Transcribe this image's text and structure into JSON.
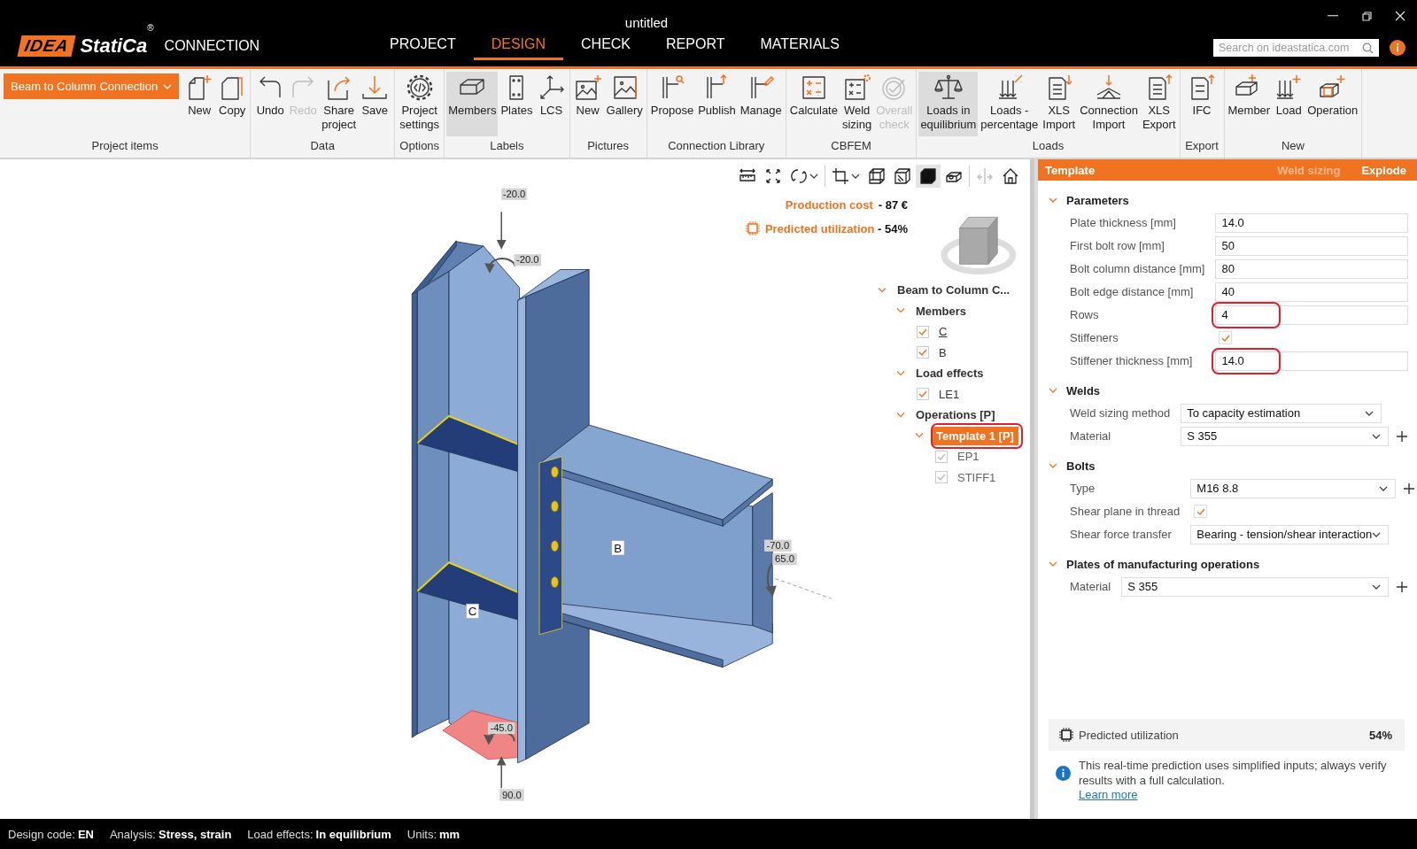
{
  "window": {
    "title": "untitled"
  },
  "logo": {
    "mark": "IDEA",
    "name": "StatiCa",
    "registered": "®",
    "product": "CONNECTION"
  },
  "menu_tabs": [
    {
      "label": "PROJECT",
      "selected": false
    },
    {
      "label": "DESIGN",
      "selected": true
    },
    {
      "label": "CHECK",
      "selected": false
    },
    {
      "label": "REPORT",
      "selected": false
    },
    {
      "label": "MATERIALS",
      "selected": false
    }
  ],
  "search": {
    "placeholder": "Search on ideastatica.com"
  },
  "ribbon": {
    "connection_dropdown": {
      "value": "Beam to Column Connection"
    },
    "groups": [
      {
        "label": "Project items",
        "buttons": [
          {
            "label": "New",
            "selected": false,
            "disabled": false
          },
          {
            "label": "Copy",
            "selected": false,
            "disabled": false
          }
        ]
      },
      {
        "label": "Data",
        "buttons": [
          {
            "label": "Undo",
            "selected": false,
            "disabled": false
          },
          {
            "label": "Redo",
            "selected": false,
            "disabled": true
          },
          {
            "label": "Share project",
            "selected": false,
            "disabled": false
          },
          {
            "label": "Save",
            "selected": false,
            "disabled": false
          }
        ]
      },
      {
        "label": "Options",
        "buttons": [
          {
            "label": "Project settings",
            "selected": false,
            "disabled": false
          }
        ]
      },
      {
        "label": "Labels",
        "buttons": [
          {
            "label": "Members",
            "selected": true,
            "disabled": false
          },
          {
            "label": "Plates",
            "selected": false,
            "disabled": false
          },
          {
            "label": "LCS",
            "selected": false,
            "disabled": false
          }
        ]
      },
      {
        "label": "Pictures",
        "buttons": [
          {
            "label": "New",
            "selected": false,
            "disabled": false
          },
          {
            "label": "Gallery",
            "selected": false,
            "disabled": false
          }
        ]
      },
      {
        "label": "Connection Library",
        "buttons": [
          {
            "label": "Propose",
            "selected": false,
            "disabled": false
          },
          {
            "label": "Publish",
            "selected": false,
            "disabled": false
          },
          {
            "label": "Manage",
            "selected": false,
            "disabled": false
          }
        ]
      },
      {
        "label": "CBFEM",
        "buttons": [
          {
            "label": "Calculate",
            "selected": false,
            "disabled": false
          },
          {
            "label": "Weld sizing",
            "selected": false,
            "disabled": false
          },
          {
            "label": "Overall check",
            "selected": false,
            "disabled": true
          }
        ]
      },
      {
        "label": "Loads",
        "buttons": [
          {
            "label": "Loads in equilibrium",
            "selected": true,
            "disabled": false
          },
          {
            "label": "Loads - percentage",
            "selected": false,
            "disabled": false
          },
          {
            "label": "XLS Import",
            "selected": false,
            "disabled": false
          },
          {
            "label": "Connection Import",
            "selected": false,
            "disabled": false
          },
          {
            "label": "XLS Export",
            "selected": false,
            "disabled": false
          }
        ]
      },
      {
        "label": "Export",
        "buttons": [
          {
            "label": "IFC",
            "selected": false,
            "disabled": false
          }
        ]
      },
      {
        "label": "New",
        "buttons": [
          {
            "label": "Member",
            "selected": false,
            "disabled": false
          },
          {
            "label": "Load",
            "selected": false,
            "disabled": false
          },
          {
            "label": "Operation",
            "selected": false,
            "disabled": false
          }
        ]
      }
    ]
  },
  "viewport": {
    "tools": [
      {
        "selected": false,
        "disabled": false
      },
      {
        "selected": false,
        "disabled": false
      },
      {
        "selected": false,
        "disabled": false
      },
      {
        "selected": false,
        "disabled": false
      },
      {
        "selected": false,
        "disabled": false
      },
      {
        "selected": false,
        "disabled": false
      },
      {
        "selected": true,
        "disabled": false
      },
      {
        "selected": false,
        "disabled": false
      },
      {
        "selected": false,
        "disabled": true
      },
      {
        "selected": false,
        "disabled": false
      }
    ],
    "production_cost": {
      "label": "Production cost",
      "value": "- 87 €"
    },
    "predicted_utilization": {
      "label": "Predicted utilization",
      "value": "- 54%"
    },
    "member_labels": [
      "B",
      "C"
    ],
    "load_values": [
      "-20.0",
      "-20.0",
      "-70.0",
      "65.0",
      "-45.0",
      "90.0"
    ],
    "tree": [
      {
        "label": "Beam to Column C...",
        "expanded": true,
        "selected": false,
        "highlighted": false,
        "children": [
          {
            "label": "Members",
            "expanded": true,
            "selected": false,
            "highlighted": false,
            "children": [
              {
                "label": "C",
                "checked": true,
                "disabled": false,
                "hovered": true,
                "selected": false,
                "highlighted": false
              },
              {
                "label": "B",
                "checked": true,
                "disabled": false,
                "hovered": false,
                "selected": false,
                "highlighted": false
              }
            ]
          },
          {
            "label": "Load effects",
            "expanded": true,
            "selected": false,
            "highlighted": false,
            "children": [
              {
                "label": "LE1",
                "checked": true,
                "disabled": false,
                "hovered": false,
                "selected": false,
                "highlighted": false
              }
            ]
          },
          {
            "label": "Operations [P]",
            "expanded": true,
            "selected": false,
            "highlighted": false,
            "children": [
              {
                "label": "Template 1 [P]",
                "expanded": true,
                "selected": true,
                "highlighted": true,
                "children": [
                  {
                    "label": "EP1",
                    "checked": true,
                    "disabled": true,
                    "hovered": false,
                    "selected": false,
                    "highlighted": false
                  },
                  {
                    "label": "STIFF1",
                    "checked": true,
                    "disabled": true,
                    "hovered": false,
                    "selected": false,
                    "highlighted": false
                  }
                ]
              }
            ]
          }
        ]
      }
    ]
  },
  "panel": {
    "title": "Template",
    "actions": [
      {
        "label": "Weld sizing",
        "disabled": true
      },
      {
        "label": "Explode",
        "disabled": false
      }
    ],
    "sections": [
      {
        "title": "Parameters",
        "expanded": true,
        "rows": [
          {
            "kind": "field",
            "label": "Plate thickness [mm]",
            "value": "14.0"
          },
          {
            "kind": "field",
            "label": "First bolt row [mm]",
            "value": "50"
          },
          {
            "kind": "field",
            "label": "Bolt column distance [mm]",
            "value": "80"
          },
          {
            "kind": "field",
            "label": "Bolt edge distance [mm]",
            "value": "40"
          },
          {
            "kind": "field",
            "label": "Rows",
            "value": "4",
            "highlighted": true
          },
          {
            "kind": "checkbox",
            "label": "Stiffeners",
            "checked": true
          },
          {
            "kind": "field",
            "label": "Stiffener thickness [mm]",
            "value": "14.0",
            "highlighted": true
          }
        ]
      },
      {
        "title": "Welds",
        "expanded": true,
        "rows": [
          {
            "kind": "dropdown",
            "label": "Weld sizing method",
            "value": "To capacity estimation"
          },
          {
            "kind": "dropdown",
            "label": "Material",
            "value": "S 355",
            "add": true
          }
        ]
      },
      {
        "title": "Bolts",
        "expanded": true,
        "rows": [
          {
            "kind": "dropdown",
            "label": "Type",
            "value": "M16 8.8",
            "add": true
          },
          {
            "kind": "checkbox",
            "label": "Shear plane in thread",
            "checked": true
          },
          {
            "kind": "dropdown",
            "label": "Shear force transfer",
            "value": "Bearing - tension/shear interaction"
          }
        ]
      },
      {
        "title": "Plates of manufacturing operations",
        "expanded": true,
        "rows": [
          {
            "kind": "dropdown",
            "label": "Material",
            "value": "S 355",
            "add": true
          }
        ]
      }
    ],
    "utilization": {
      "label": "Predicted utilization",
      "value": "54%"
    },
    "info": {
      "text": "This real-time prediction uses simplified inputs; always verify results with a full calculation.",
      "link": "Learn more"
    }
  },
  "status_bar": [
    {
      "label": "Design code:",
      "value": "EN"
    },
    {
      "label": "Analysis:",
      "value": "Stress, strain"
    },
    {
      "label": "Load effects:",
      "value": "In equilibrium"
    },
    {
      "label": "Units:",
      "value": "mm"
    }
  ]
}
